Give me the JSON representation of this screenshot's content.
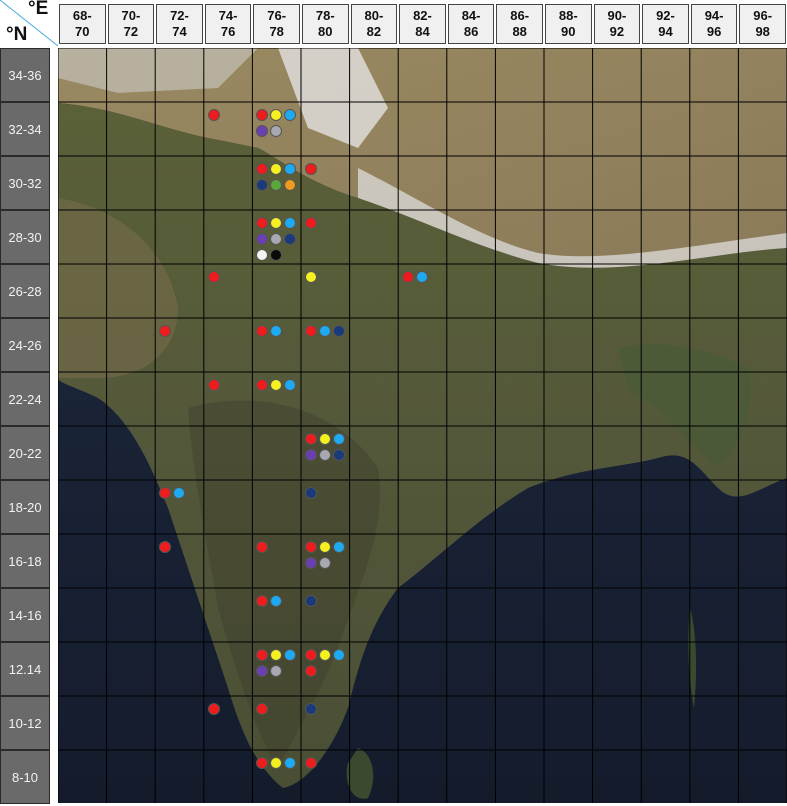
{
  "axes": {
    "lon_unit": "°E",
    "lat_unit": "°N"
  },
  "columns": [
    "68-\n70",
    "70-\n72",
    "72-\n74",
    "74-\n76",
    "76-\n78",
    "78-\n80",
    "80-\n82",
    "82-\n84",
    "84-\n86",
    "86-\n88",
    "88-\n90",
    "90-\n92",
    "92-\n94",
    "94-\n96",
    "96-\n98"
  ],
  "rows": [
    "34-36",
    "32-34",
    "30-32",
    "28-30",
    "26-28",
    "24-26",
    "22-24",
    "20-22",
    "18-20",
    "16-18",
    "14-16",
    "12.14",
    "10-12",
    "8-10"
  ],
  "colors": {
    "red": "#ee1c1c",
    "yellow": "#f5f020",
    "cyan": "#1eaaf0",
    "gray": "#a8a8b0",
    "purple": "#6a3fb0",
    "navy": "#1a3a7a",
    "green": "#5aa83a",
    "orange": "#f09a1e",
    "black": "#0a0a0a",
    "white": "#f4f4f4"
  },
  "markers": [
    {
      "col": 3,
      "row": 1,
      "c": "red"
    },
    {
      "col": 4,
      "row": 1,
      "c": "red"
    },
    {
      "col": 4,
      "row": 1,
      "c": "yellow"
    },
    {
      "col": 4,
      "row": 1,
      "c": "cyan"
    },
    {
      "col": 4,
      "row": 1,
      "c": "purple"
    },
    {
      "col": 4,
      "row": 1,
      "c": "gray"
    },
    {
      "col": 4,
      "row": 2,
      "c": "red"
    },
    {
      "col": 4,
      "row": 2,
      "c": "yellow"
    },
    {
      "col": 4,
      "row": 2,
      "c": "cyan"
    },
    {
      "col": 4,
      "row": 2,
      "c": "navy"
    },
    {
      "col": 4,
      "row": 2,
      "c": "green"
    },
    {
      "col": 4,
      "row": 2,
      "c": "orange"
    },
    {
      "col": 5,
      "row": 2,
      "c": "red"
    },
    {
      "col": 4,
      "row": 3,
      "c": "red"
    },
    {
      "col": 4,
      "row": 3,
      "c": "yellow"
    },
    {
      "col": 4,
      "row": 3,
      "c": "cyan"
    },
    {
      "col": 4,
      "row": 3,
      "c": "purple"
    },
    {
      "col": 4,
      "row": 3,
      "c": "gray"
    },
    {
      "col": 4,
      "row": 3,
      "c": "navy"
    },
    {
      "col": 4,
      "row": 3,
      "c": "white"
    },
    {
      "col": 4,
      "row": 3,
      "c": "black"
    },
    {
      "col": 5,
      "row": 3,
      "c": "red"
    },
    {
      "col": 3,
      "row": 4,
      "c": "red"
    },
    {
      "col": 5,
      "row": 4,
      "c": "yellow"
    },
    {
      "col": 7,
      "row": 4,
      "c": "red"
    },
    {
      "col": 7,
      "row": 4,
      "c": "cyan"
    },
    {
      "col": 2,
      "row": 5,
      "c": "red"
    },
    {
      "col": 4,
      "row": 5,
      "c": "red"
    },
    {
      "col": 4,
      "row": 5,
      "c": "cyan"
    },
    {
      "col": 5,
      "row": 5,
      "c": "red"
    },
    {
      "col": 5,
      "row": 5,
      "c": "cyan"
    },
    {
      "col": 5,
      "row": 5,
      "c": "navy"
    },
    {
      "col": 3,
      "row": 6,
      "c": "red"
    },
    {
      "col": 4,
      "row": 6,
      "c": "red"
    },
    {
      "col": 4,
      "row": 6,
      "c": "yellow"
    },
    {
      "col": 4,
      "row": 6,
      "c": "cyan"
    },
    {
      "col": 5,
      "row": 7,
      "c": "red"
    },
    {
      "col": 5,
      "row": 7,
      "c": "yellow"
    },
    {
      "col": 5,
      "row": 7,
      "c": "cyan"
    },
    {
      "col": 5,
      "row": 7,
      "c": "purple"
    },
    {
      "col": 5,
      "row": 7,
      "c": "gray"
    },
    {
      "col": 5,
      "row": 7,
      "c": "navy"
    },
    {
      "col": 2,
      "row": 8,
      "c": "red"
    },
    {
      "col": 2,
      "row": 8,
      "c": "cyan"
    },
    {
      "col": 5,
      "row": 8,
      "c": "navy"
    },
    {
      "col": 2,
      "row": 9,
      "c": "red"
    },
    {
      "col": 4,
      "row": 9,
      "c": "red"
    },
    {
      "col": 5,
      "row": 9,
      "c": "red"
    },
    {
      "col": 5,
      "row": 9,
      "c": "yellow"
    },
    {
      "col": 5,
      "row": 9,
      "c": "cyan"
    },
    {
      "col": 5,
      "row": 9,
      "c": "purple"
    },
    {
      "col": 5,
      "row": 9,
      "c": "gray"
    },
    {
      "col": 4,
      "row": 10,
      "c": "red"
    },
    {
      "col": 4,
      "row": 10,
      "c": "cyan"
    },
    {
      "col": 5,
      "row": 10,
      "c": "navy"
    },
    {
      "col": 4,
      "row": 11,
      "c": "red"
    },
    {
      "col": 4,
      "row": 11,
      "c": "yellow"
    },
    {
      "col": 4,
      "row": 11,
      "c": "cyan"
    },
    {
      "col": 4,
      "row": 11,
      "c": "purple"
    },
    {
      "col": 4,
      "row": 11,
      "c": "gray"
    },
    {
      "col": 5,
      "row": 11,
      "c": "red"
    },
    {
      "col": 5,
      "row": 11,
      "c": "yellow"
    },
    {
      "col": 5,
      "row": 11,
      "c": "cyan"
    },
    {
      "col": 5,
      "row": 11,
      "c": "red"
    },
    {
      "col": 3,
      "row": 12,
      "c": "red"
    },
    {
      "col": 4,
      "row": 12,
      "c": "red"
    },
    {
      "col": 5,
      "row": 12,
      "c": "navy"
    },
    {
      "col": 4,
      "row": 13,
      "c": "red"
    },
    {
      "col": 4,
      "row": 13,
      "c": "yellow"
    },
    {
      "col": 4,
      "row": 13,
      "c": "cyan"
    },
    {
      "col": 5,
      "row": 13,
      "c": "red"
    }
  ]
}
